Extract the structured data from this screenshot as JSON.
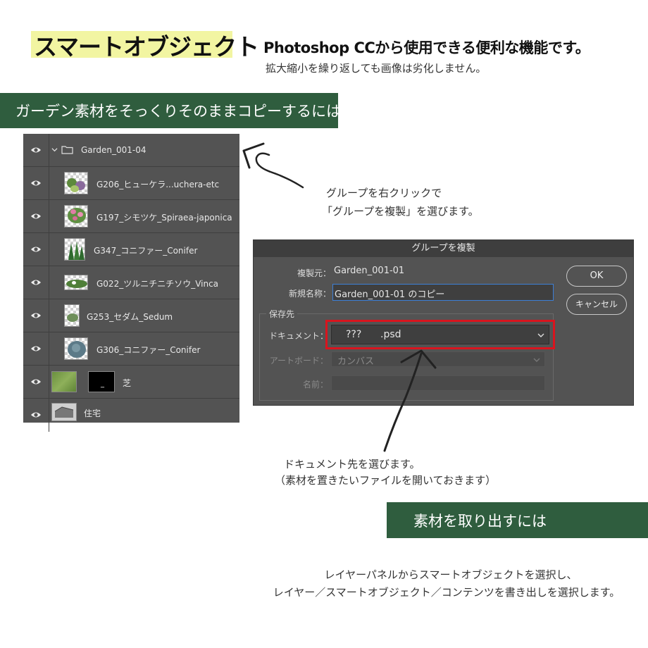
{
  "header": {
    "title": "スマートオブジェクト",
    "subtitle": "Photoshop CCから使用できる便利な機能です。",
    "note": "拡大縮小を繰り返しても画像は劣化しません。"
  },
  "section1": {
    "banner": "ガーデン素材をそっくりそのままコピーするには"
  },
  "layers_panel": {
    "group": {
      "name": "Garden_001-04"
    },
    "layers": [
      {
        "name": "G206_ヒューケラ...uchera-etc"
      },
      {
        "name": "G197_シモツケ_Spiraea-japonica"
      },
      {
        "name": "G347_コニファー_Conifer"
      },
      {
        "name": "G022_ツルニチニチソウ_Vinca"
      },
      {
        "name": "G253_セダム_Sedum"
      },
      {
        "name": "G306_コニファー_Conifer"
      },
      {
        "name": "芝"
      },
      {
        "name": "住宅"
      }
    ],
    "mask_char": "_"
  },
  "annotation1": {
    "line1": "グループを右クリックで",
    "line2": "「グループを複製」を選びます。"
  },
  "dialog": {
    "title": "グループを複製",
    "source_label": "複製元：",
    "source_value": "Garden_001-01",
    "newname_label": "新規名称：",
    "newname_value": "Garden_001-01 のコピー",
    "dest_section": "保存先",
    "document_label": "ドキュメント：",
    "document_value": "???      .psd",
    "artboard_label": "アートボード：",
    "artboard_value": "カンバス",
    "name_label": "名前：",
    "ok_label": "OK",
    "cancel_label": "キャンセル",
    "highlight_color": "#d9141e"
  },
  "annotation2": {
    "line1": "ドキュメント先を選びます。",
    "line2": "（素材を置きたいファイルを開いておきます）"
  },
  "section2": {
    "banner": "素材を取り出すには",
    "line1": "レイヤーパネルからスマートオブジェクトを選択し、",
    "line2": "レイヤー／スマートオブジェクト／コンテンツを書き出しを選択します。"
  },
  "colors": {
    "banner_bg": "#2f5d3e",
    "title_highlight": "#f2f5a2",
    "panel_bg": "#535353"
  }
}
